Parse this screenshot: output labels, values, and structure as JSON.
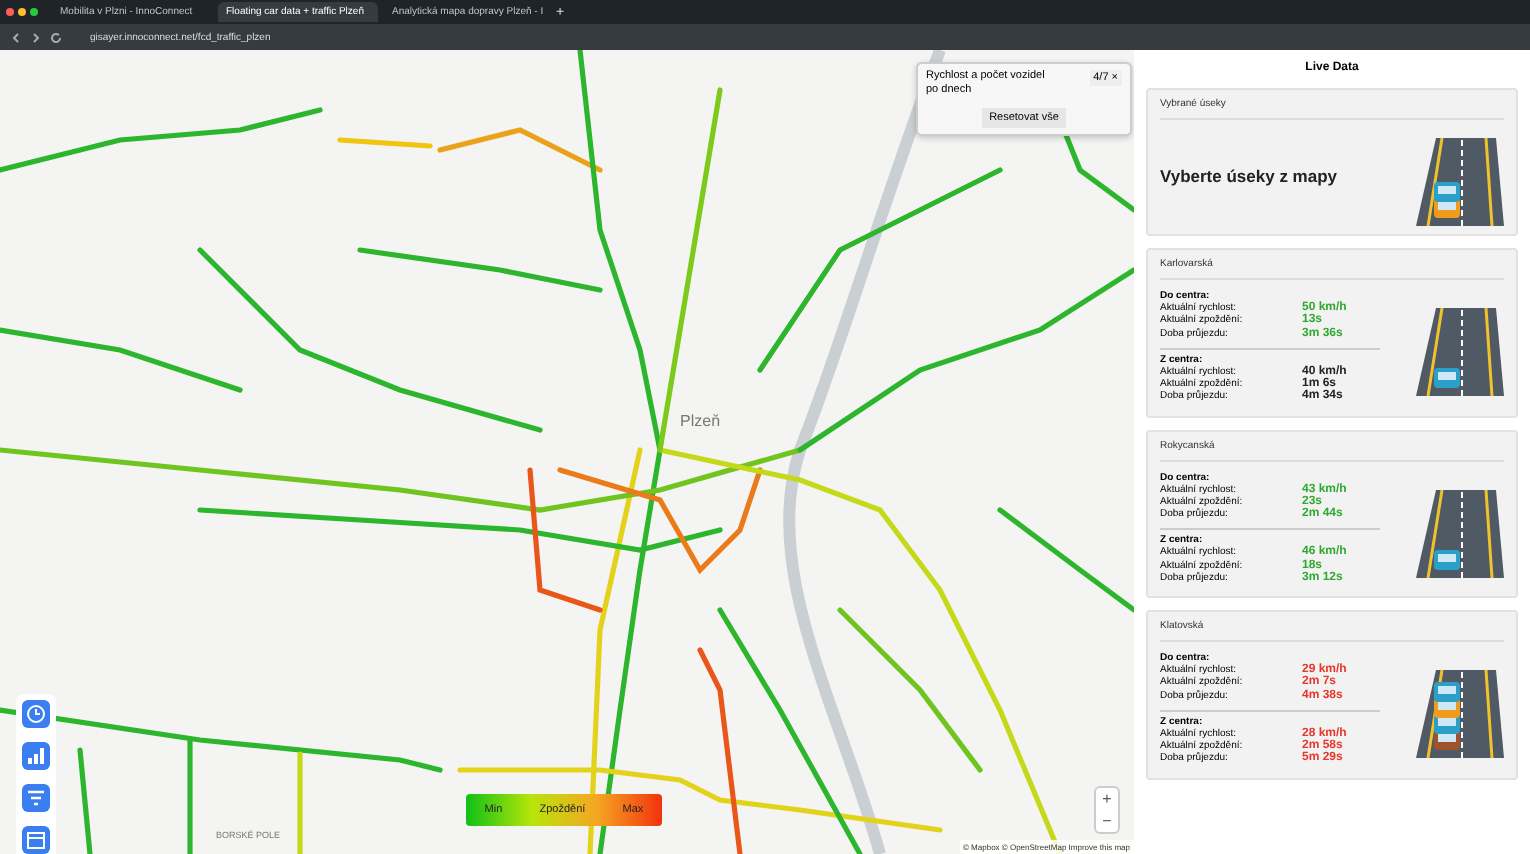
{
  "browser": {
    "tabs": [
      {
        "label": "Mobilita v Plzni - InnoConnect",
        "selected": false
      },
      {
        "label": "Floating car data + traffic Plzeň",
        "selected": true
      },
      {
        "label": "Analytická mapa dopravy Plzeň - I",
        "selected": false
      }
    ],
    "new_tab": "+",
    "address": "gisayer.innoconnect.net/fcd_traffic_plzen"
  },
  "map": {
    "place_labels": [
      {
        "text": "Plzeň",
        "kind": "city"
      },
      {
        "text": "BORSKÉ POLE",
        "kind": "district"
      }
    ],
    "filter_popup": {
      "title": "Rychlost a počet vozidel po dnech",
      "count": "4/7 ×",
      "reset": "Resetovat vše"
    },
    "tools": [
      {
        "kind": "clock"
      },
      {
        "kind": "chart"
      },
      {
        "kind": "filter"
      },
      {
        "kind": "calendar"
      }
    ],
    "legend": {
      "min": "Min",
      "label": "Zpoždění",
      "max": "Max"
    },
    "zoom": {
      "in": "+",
      "out": "−"
    },
    "attribution": "© Mapbox © OpenStreetMap Improve this map"
  },
  "panel": {
    "title": "Live Data",
    "cards": [
      {
        "kind": "empty",
        "title": "Vybrané úseky",
        "message": "Vyberte úseky z mapy",
        "illustration": {
          "kind": "two_cars"
        }
      },
      {
        "kind": "segment",
        "title": "Karlovarská",
        "illustration": {
          "kind": "one_car"
        },
        "directions": [
          {
            "heading": "Do centra:",
            "rows": [
              {
                "label": "Aktuální rychlost:",
                "value": "50 km/h",
                "color": "#2fa82f"
              },
              {
                "label": "Aktuální zpoždění:",
                "value": "13s",
                "color": "#2fa82f"
              },
              {
                "label": "Doba průjezdu:",
                "value": "3m 36s",
                "color": "#2fa82f"
              }
            ]
          },
          {
            "heading": "Z centra:",
            "rows": [
              {
                "label": "Aktuální rychlost:",
                "value": "40 km/h",
                "color": "#222222"
              },
              {
                "label": "Aktuální zpoždění:",
                "value": "1m 6s",
                "color": "#222222"
              },
              {
                "label": "Doba průjezdu:",
                "value": "4m 34s",
                "color": "#222222"
              }
            ]
          }
        ]
      },
      {
        "kind": "segment",
        "title": "Rokycanská",
        "illustration": {
          "kind": "one_car"
        },
        "directions": [
          {
            "heading": "Do centra:",
            "rows": [
              {
                "label": "Aktuální rychlost:",
                "value": "43 km/h",
                "color": "#2fa82f"
              },
              {
                "label": "Aktuální zpoždění:",
                "value": "23s",
                "color": "#2fa82f"
              },
              {
                "label": "Doba průjezdu:",
                "value": "2m 44s",
                "color": "#2fa82f"
              }
            ]
          },
          {
            "heading": "Z centra:",
            "rows": [
              {
                "label": "Aktuální rychlost:",
                "value": "46 km/h",
                "color": "#2fa82f"
              },
              {
                "label": "Aktuální zpoždění:",
                "value": "18s",
                "color": "#2fa82f"
              },
              {
                "label": "Doba průjezdu:",
                "value": "3m 12s",
                "color": "#2fa82f"
              }
            ]
          }
        ]
      },
      {
        "kind": "segment",
        "title": "Klatovská",
        "illustration": {
          "kind": "jam"
        },
        "directions": [
          {
            "heading": "Do centra:",
            "rows": [
              {
                "label": "Aktuální rychlost:",
                "value": "29 km/h",
                "color": "#e8352a"
              },
              {
                "label": "Aktuální zpoždění:",
                "value": "2m 7s",
                "color": "#e8352a"
              },
              {
                "label": "Doba průjezdu:",
                "value": "4m 38s",
                "color": "#e8352a"
              }
            ]
          },
          {
            "heading": "Z centra:",
            "rows": [
              {
                "label": "Aktuální rychlost:",
                "value": "28 km/h",
                "color": "#e8352a"
              },
              {
                "label": "Aktuální zpoždění:",
                "value": "2m 58s",
                "color": "#e8352a"
              },
              {
                "label": "Doba průjezdu:",
                "value": "5m 29s",
                "color": "#e8352a"
              }
            ]
          }
        ]
      }
    ]
  }
}
